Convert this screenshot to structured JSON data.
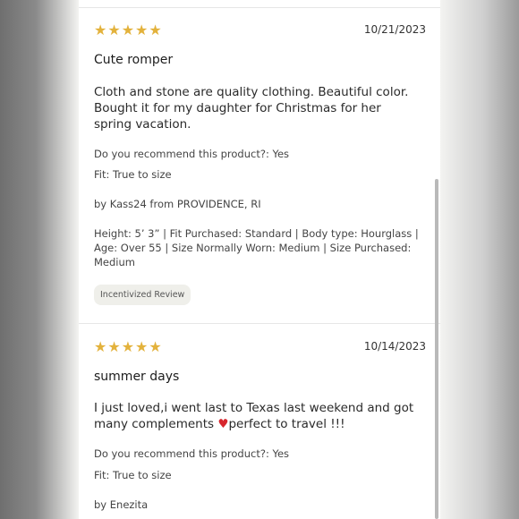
{
  "reviews": [
    {
      "stars": "★★★★★",
      "rating": 5,
      "date": "10/21/2023",
      "title": "Cute romper",
      "text": "Cloth and stone are quality clothing. Beautiful color. Bought it for my daughter for Christmas for her spring vacation.",
      "recommend": "Do you recommend this product?: Yes",
      "fit": "Fit: True to size",
      "author": "by Kass24 from PROVIDENCE, RI",
      "details": "Height: 5’ 3”   |   Fit Purchased: Standard   |   Body type: Hourglass   |   Age: Over 55   |   Size Normally Worn: Medium   |   Size Purchased: Medium",
      "badge": "Incentivized Review"
    },
    {
      "stars": "★★★★★",
      "rating": 5,
      "date": "10/14/2023",
      "title": "summer days",
      "text_before": "I just loved,i went last to Texas last weekend and got many complements ",
      "heart": "♥",
      "text_after": "perfect to travel !!!",
      "recommend": "Do you recommend this product?: Yes",
      "fit": "Fit: True to size",
      "author": "by Enezita"
    }
  ]
}
